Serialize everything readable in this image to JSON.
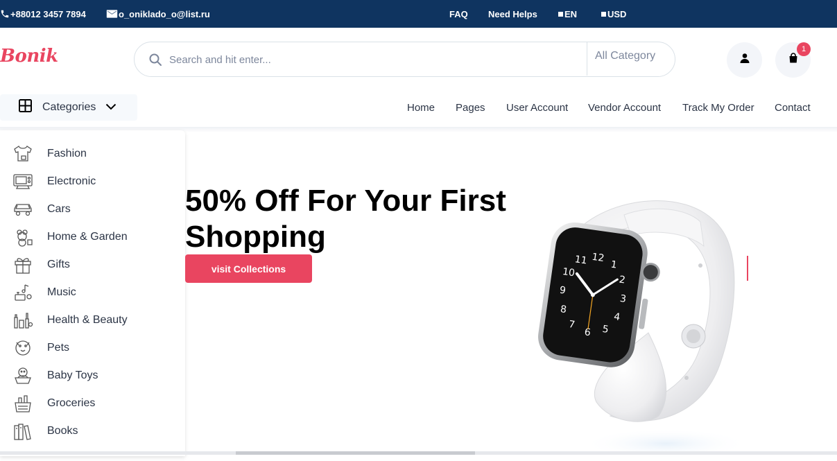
{
  "topbar": {
    "phone": "+88012 3457 7894",
    "email": "o_oniklado_o@list.ru",
    "faq": "FAQ",
    "help": "Need Helps",
    "language": "EN",
    "currency": "USD"
  },
  "header": {
    "logo": "Bonik",
    "search_placeholder": "Search and hit enter...",
    "search_value": "",
    "category_select": "All Category",
    "cart_count": "1"
  },
  "nav": {
    "categories_label": "Categories",
    "links": [
      "Home",
      "Pages",
      "User Account",
      "Vendor Account",
      "Track My Order",
      "Contact"
    ]
  },
  "sidebar": {
    "items": [
      {
        "label": "Fashion",
        "icon": "fashion-icon"
      },
      {
        "label": "Electronic",
        "icon": "electronic-icon"
      },
      {
        "label": "Cars",
        "icon": "car-icon"
      },
      {
        "label": "Home & Garden",
        "icon": "home-garden-icon"
      },
      {
        "label": "Gifts",
        "icon": "gift-icon"
      },
      {
        "label": "Music",
        "icon": "music-icon"
      },
      {
        "label": "Health & Beauty",
        "icon": "health-beauty-icon"
      },
      {
        "label": "Pets",
        "icon": "pets-icon"
      },
      {
        "label": "Baby Toys",
        "icon": "baby-toys-icon"
      },
      {
        "label": "Groceries",
        "icon": "groceries-icon"
      },
      {
        "label": "Books",
        "icon": "books-icon"
      }
    ]
  },
  "hero": {
    "title": "50% Off For Your First Shopping",
    "button": "visit Collections",
    "image": "smartwatch-image"
  },
  "colors": {
    "topbar": "#0f3460",
    "accent": "#e94560",
    "text": "#2b3445"
  }
}
